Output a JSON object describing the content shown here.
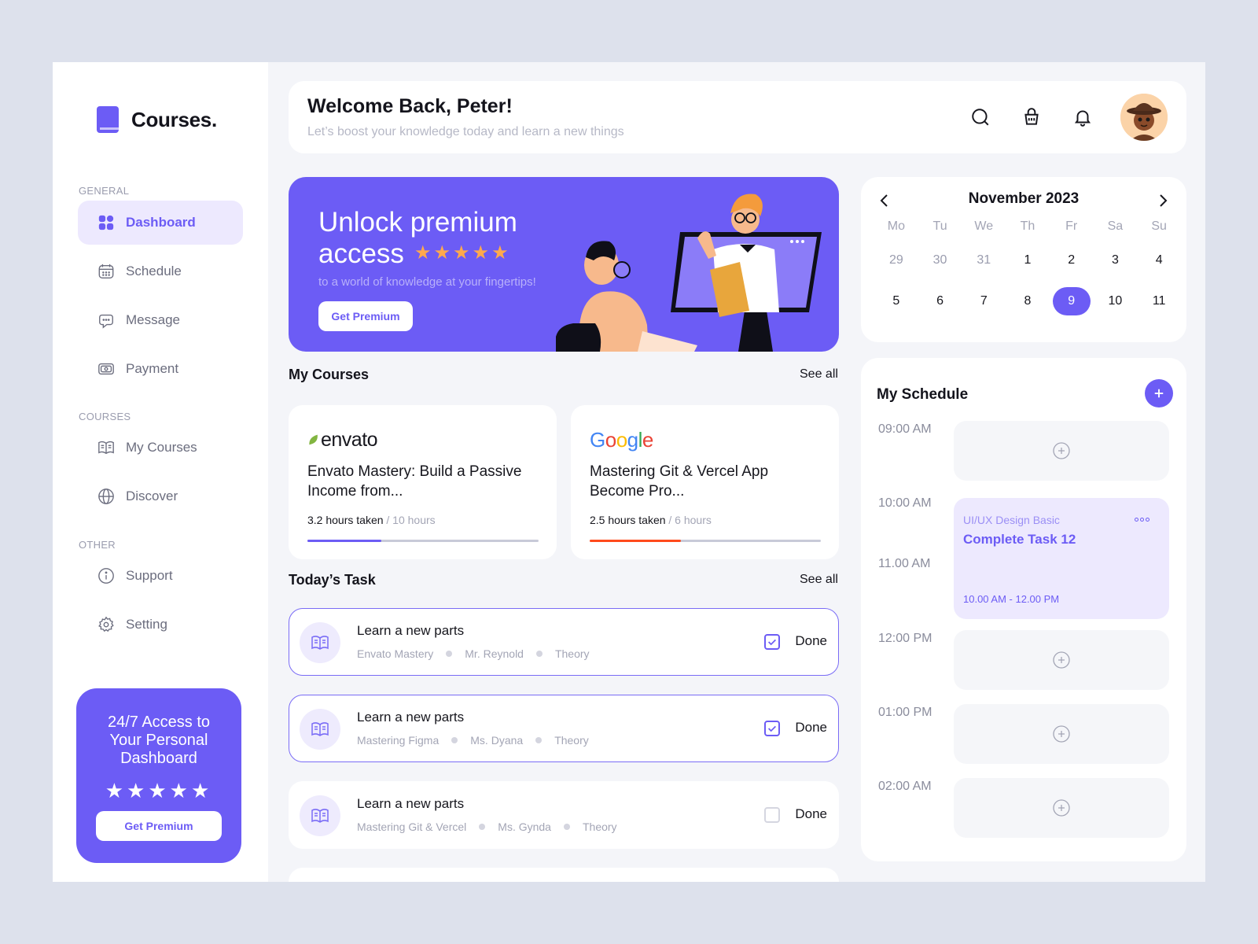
{
  "app": {
    "brand": "Courses."
  },
  "sidebar": {
    "sections": {
      "general": "GENERAL",
      "courses": "COURSES",
      "other": "OTHER"
    },
    "items": [
      {
        "label": "Dashboard",
        "icon": "dashboard-icon",
        "active": true
      },
      {
        "label": "Schedule",
        "icon": "calendar-icon"
      },
      {
        "label": "Message",
        "icon": "message-icon"
      },
      {
        "label": "Payment",
        "icon": "payment-icon"
      },
      {
        "label": "My Courses",
        "icon": "book-icon"
      },
      {
        "label": "Discover",
        "icon": "globe-icon"
      },
      {
        "label": "Support",
        "icon": "info-icon"
      },
      {
        "label": "Setting",
        "icon": "gear-icon"
      }
    ],
    "promo": {
      "text": "24/7 Access to Your Personal Dashboard",
      "stars": "★★★★★",
      "button": "Get Premium"
    }
  },
  "header": {
    "title": "Welcome Back, Peter!",
    "subtitle": "Let’s boost your knowledge today and learn a new things",
    "icons": [
      "search-icon",
      "basket-icon",
      "bell-icon"
    ]
  },
  "banner": {
    "title": "Unlock premium access",
    "stars": "★★★★★",
    "subtitle": "to a world of knowledge at your fingertips!",
    "button": "Get Premium"
  },
  "my_courses": {
    "title": "My Courses",
    "see_all": "See all",
    "items": [
      {
        "provider": "envato",
        "title": "Envato Mastery: Build a Passive Income from...",
        "taken": "3.2 hours taken",
        "total": " / 10 hours",
        "progress": 0.32,
        "color": "#6c5cf5"
      },
      {
        "provider": "Google",
        "title": "Mastering Git & Vercel App Become Pro...",
        "taken": "2.5 hours taken",
        "total": " / 6 hours",
        "progress": 0.396,
        "color": "#ff4a1c"
      }
    ]
  },
  "todays_task": {
    "title": "Today’s Task",
    "see_all": "See all",
    "items": [
      {
        "title": "Learn a new parts",
        "course": "Envato Mastery",
        "mentor": "Mr. Reynold",
        "type": "Theory",
        "done_label": "Done",
        "done": true
      },
      {
        "title": "Learn a new parts",
        "course": "Mastering Figma",
        "mentor": "Ms. Dyana",
        "type": "Theory",
        "done_label": "Done",
        "done": true
      },
      {
        "title": "Learn a new parts",
        "course": "Mastering Git & Vercel",
        "mentor": "Ms. Gynda",
        "type": "Theory",
        "done_label": "Done",
        "done": false
      }
    ]
  },
  "calendar": {
    "month": "November 2023",
    "weekdays": [
      "Mo",
      "Tu",
      "We",
      "Th",
      "Fr",
      "Sa",
      "Su"
    ],
    "days": [
      "29",
      "30",
      "31",
      "1",
      "2",
      "3",
      "4",
      "5",
      "6",
      "7",
      "8",
      "9",
      "10",
      "11"
    ],
    "muted_days": 3,
    "selected": "9"
  },
  "schedule": {
    "title": "My Schedule",
    "times": [
      "09:00 AM",
      "10:00 AM",
      "11.00 AM",
      "12:00 PM",
      "01:00 PM",
      "02:00 AM"
    ],
    "event": {
      "category": "UI/UX Design Basic",
      "title": "Complete Task 12",
      "time": "10.00 AM - 12.00 PM"
    }
  },
  "colors": {
    "accent": "#6c5cf5",
    "accent_light": "#ede9fe",
    "star": "#ffa94d",
    "google_progress": "#ff4a1c"
  }
}
